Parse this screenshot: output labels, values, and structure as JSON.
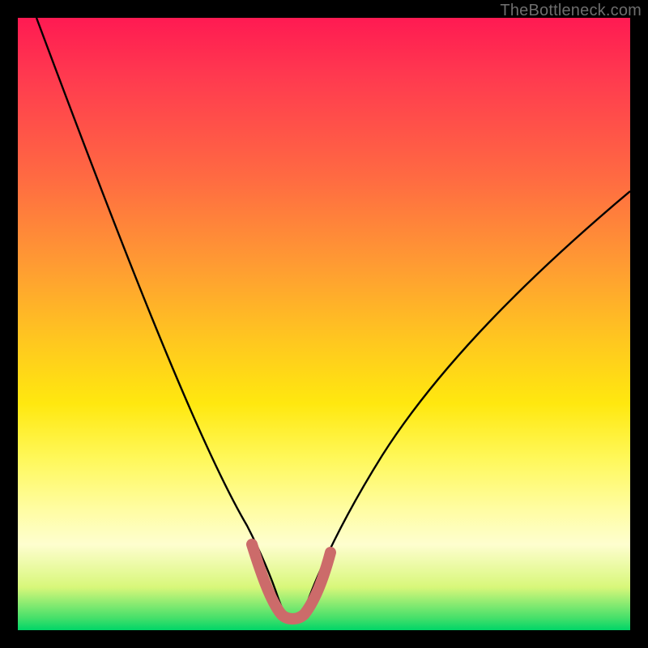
{
  "watermark": "TheBottleneck.com",
  "colors": {
    "page_bg": "#000000",
    "gradient_top": "#ff1a52",
    "gradient_mid": "#ffe80f",
    "gradient_bottom": "#00d568",
    "curve": "#000000",
    "highlight": "#cc6b6a"
  },
  "chart_data": {
    "type": "line",
    "title": "",
    "xlabel": "",
    "ylabel": "",
    "xlim": [
      0,
      100
    ],
    "ylim": [
      0,
      100
    ],
    "annotations": [],
    "series": [
      {
        "name": "curve",
        "x": [
          3,
          8,
          13,
          18,
          23,
          28,
          32,
          35.5,
          38,
          40,
          42,
          44,
          46,
          48,
          50,
          54,
          60,
          66,
          72,
          80,
          90,
          100
        ],
        "y": [
          100,
          88,
          76,
          64,
          52,
          40,
          28,
          18,
          10,
          5,
          2.5,
          1.8,
          2.5,
          5,
          9,
          17,
          28,
          38,
          46,
          55,
          64,
          72
        ]
      },
      {
        "name": "highlight-band",
        "x": [
          37.5,
          39,
          40.5,
          42,
          43.5,
          45,
          46.5,
          48,
          49.5,
          51
        ],
        "y": [
          11,
          6.5,
          3.5,
          2.2,
          1.8,
          2.2,
          3.5,
          6,
          9.5,
          13
        ]
      }
    ]
  }
}
